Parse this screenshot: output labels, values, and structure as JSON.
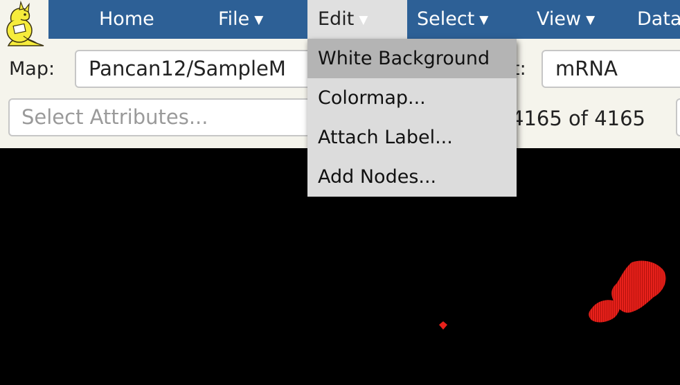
{
  "nav": {
    "home": "Home",
    "file": "File",
    "edit": "Edit",
    "select": "Select",
    "view": "View",
    "data": "Data",
    "caret": "▼"
  },
  "controls": {
    "map_label": "Map:",
    "map_value": "Pancan12/SampleM",
    "layout_label_visible": "t:",
    "layout_value": "mRNA",
    "attributes_placeholder": "Select Attributes...",
    "count_text": "4165 of 4165"
  },
  "edit_menu": {
    "items": [
      "White Background",
      "Colormap...",
      "Attach Label...",
      "Add Nodes..."
    ],
    "highlighted_index": 0
  },
  "colors": {
    "navbar": "#2d6096",
    "panel": "#f5f4ec",
    "map_background": "#000000",
    "node": "#e8211b"
  },
  "icons": {
    "logo": "yellow-kangaroo-reading-logo"
  }
}
